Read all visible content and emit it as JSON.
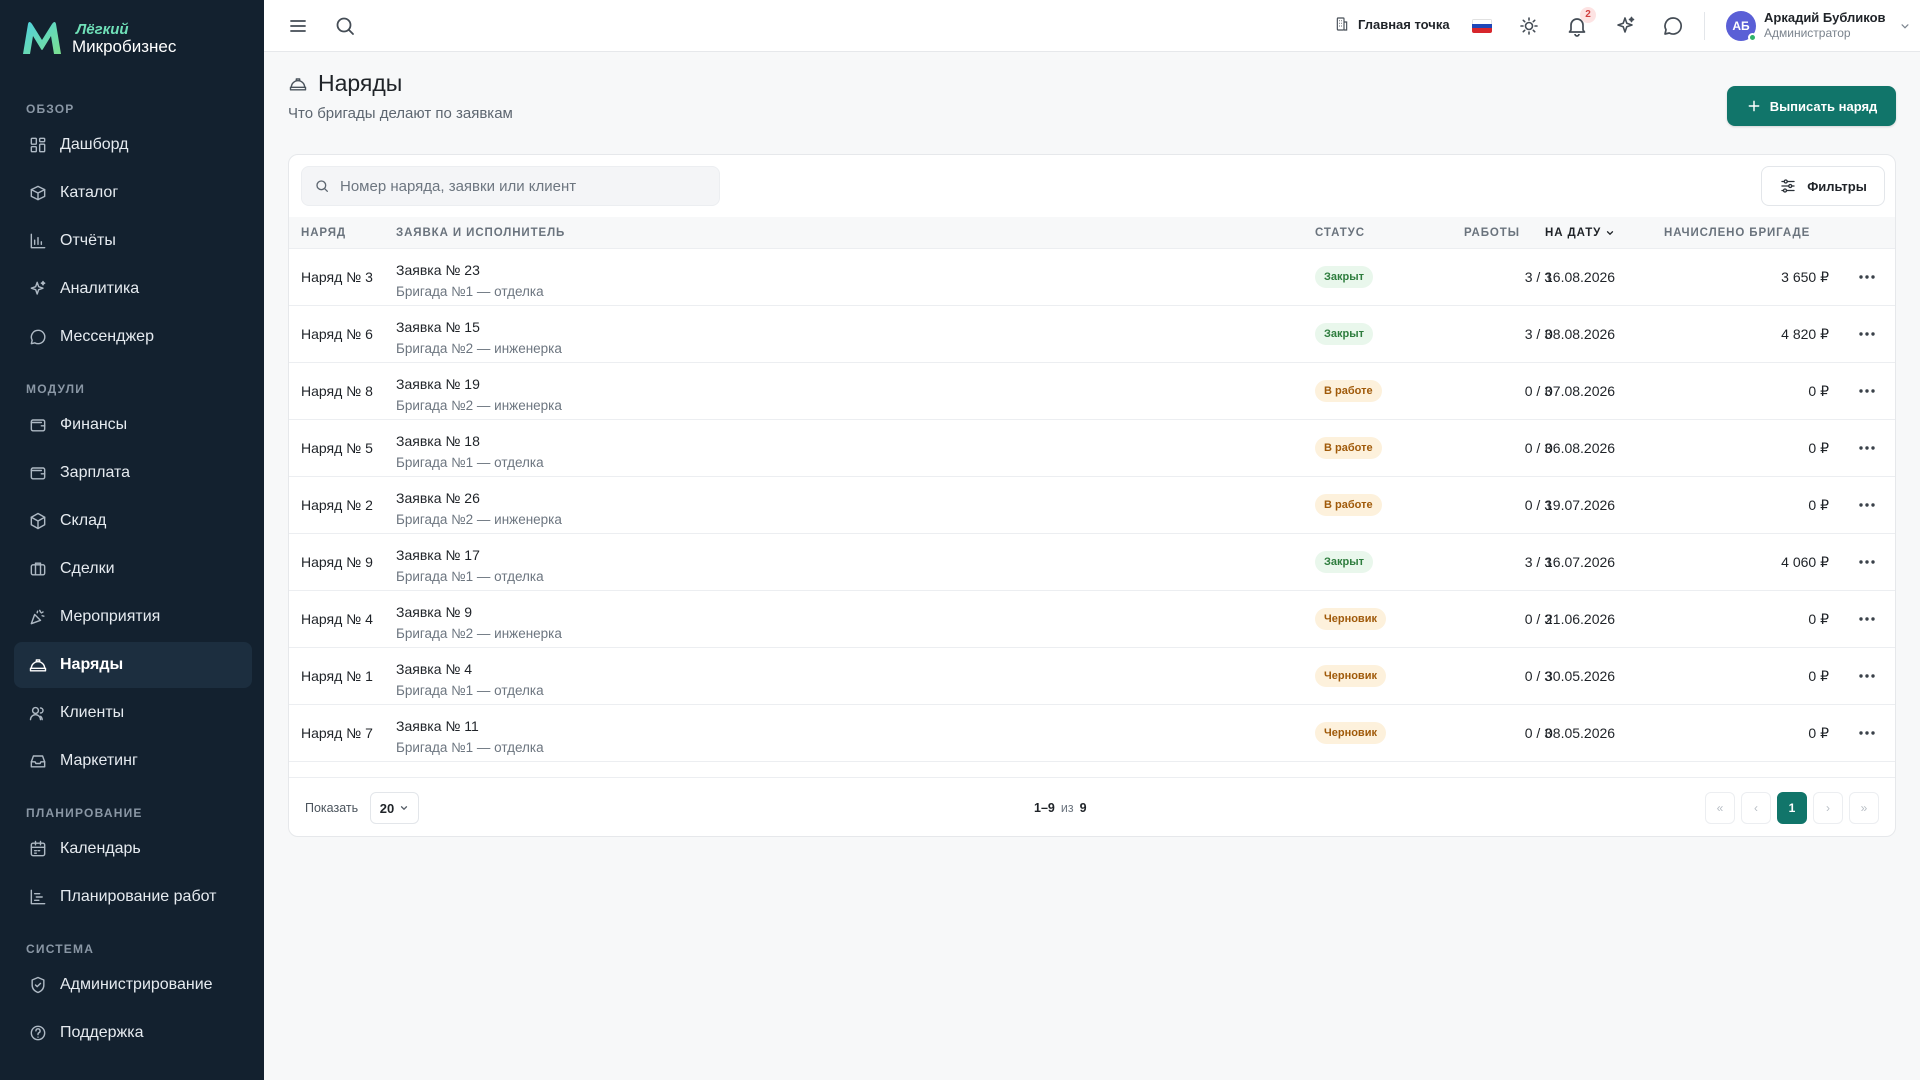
{
  "brand": {
    "line1": "Лёгкий",
    "line2": "Микробизнес"
  },
  "sidebar": {
    "sections": [
      {
        "title": "Обзор",
        "items": [
          {
            "label": "Дашборд",
            "icon": "grid-icon"
          },
          {
            "label": "Каталог",
            "icon": "box-icon"
          },
          {
            "label": "Отчёты",
            "icon": "bar-chart-icon"
          },
          {
            "label": "Аналитика",
            "icon": "sparkles-icon"
          },
          {
            "label": "Мессенджер",
            "icon": "message-icon"
          }
        ]
      },
      {
        "title": "Модули",
        "items": [
          {
            "label": "Финансы",
            "icon": "wallet-icon"
          },
          {
            "label": "Зарплата",
            "icon": "wallet-icon"
          },
          {
            "label": "Склад",
            "icon": "cube-icon"
          },
          {
            "label": "Сделки",
            "icon": "briefcase-icon"
          },
          {
            "label": "Мероприятия",
            "icon": "party-icon"
          },
          {
            "label": "Наряды",
            "icon": "helmet-icon",
            "active": true
          },
          {
            "label": "Клиенты",
            "icon": "users-icon"
          },
          {
            "label": "Маркетинг",
            "icon": "inbox-icon"
          }
        ]
      },
      {
        "title": "Планирование",
        "items": [
          {
            "label": "Календарь",
            "icon": "calendar-icon"
          },
          {
            "label": "Планирование работ",
            "icon": "gantt-icon"
          }
        ]
      },
      {
        "title": "Система",
        "items": [
          {
            "label": "Администрирование",
            "icon": "shield-icon"
          },
          {
            "label": "Поддержка",
            "icon": "help-icon"
          }
        ]
      }
    ]
  },
  "topbar": {
    "location": "Главная точка",
    "notifications_count": "2",
    "user": {
      "initials": "АБ",
      "name": "Аркадий Бубликов",
      "role": "Администратор"
    }
  },
  "page": {
    "title": "Наряды",
    "subtitle": "Что бригады делают по заявкам",
    "primary_button": "Выписать наряд"
  },
  "toolbar": {
    "search_placeholder": "Номер наряда, заявки или клиент",
    "filters_label": "Фильтры"
  },
  "table": {
    "headers": {
      "num": "Наряд",
      "request": "Заявка и исполнитель",
      "status": "Статус",
      "works": "Работы",
      "date": "На дату",
      "amount": "Начислено бригаде"
    },
    "rows": [
      {
        "num": "Наряд № 3",
        "request": "Заявка № 23",
        "team": "Бригада №1 — отделка",
        "status": "Закрыт",
        "status_type": "closed",
        "works": "3 / 3",
        "date": "16.08.2026",
        "amount": "3 650 ₽"
      },
      {
        "num": "Наряд № 6",
        "request": "Заявка № 15",
        "team": "Бригада №2 — инженерка",
        "status": "Закрыт",
        "status_type": "closed",
        "works": "3 / 3",
        "date": "08.08.2026",
        "amount": "4 820 ₽"
      },
      {
        "num": "Наряд № 8",
        "request": "Заявка № 19",
        "team": "Бригада №2 — инженерка",
        "status": "В работе",
        "status_type": "work",
        "works": "0 / 3",
        "date": "07.08.2026",
        "amount": "0 ₽"
      },
      {
        "num": "Наряд № 5",
        "request": "Заявка № 18",
        "team": "Бригада №1 — отделка",
        "status": "В работе",
        "status_type": "work",
        "works": "0 / 3",
        "date": "06.08.2026",
        "amount": "0 ₽"
      },
      {
        "num": "Наряд № 2",
        "request": "Заявка № 26",
        "team": "Бригада №2 — инженерка",
        "status": "В работе",
        "status_type": "work",
        "works": "0 / 3",
        "date": "19.07.2026",
        "amount": "0 ₽"
      },
      {
        "num": "Наряд № 9",
        "request": "Заявка № 17",
        "team": "Бригада №1 — отделка",
        "status": "Закрыт",
        "status_type": "closed",
        "works": "3 / 3",
        "date": "16.07.2026",
        "amount": "4 060 ₽"
      },
      {
        "num": "Наряд № 4",
        "request": "Заявка № 9",
        "team": "Бригада №2 — инженерка",
        "status": "Черновик",
        "status_type": "draft",
        "works": "0 / 3",
        "date": "21.06.2026",
        "amount": "0 ₽"
      },
      {
        "num": "Наряд № 1",
        "request": "Заявка № 4",
        "team": "Бригада №1 — отделка",
        "status": "Черновик",
        "status_type": "draft",
        "works": "0 / 3",
        "date": "30.05.2026",
        "amount": "0 ₽"
      },
      {
        "num": "Наряд № 7",
        "request": "Заявка № 11",
        "team": "Бригада №1 — отделка",
        "status": "Черновик",
        "status_type": "draft",
        "works": "0 / 3",
        "date": "08.05.2026",
        "amount": "0 ₽"
      }
    ]
  },
  "pagination": {
    "show_label": "Показать",
    "per_page": "20",
    "range": "1–9",
    "of": "из",
    "total": "9",
    "current_page": "1",
    "first": "«",
    "prev": "‹",
    "next": "›",
    "last": "»"
  },
  "colors": {
    "accent": "#11756a",
    "sidebar_bg": "#13212f",
    "closed_bg": "#e9f7ec",
    "pending_bg": "#fdf1dc"
  }
}
